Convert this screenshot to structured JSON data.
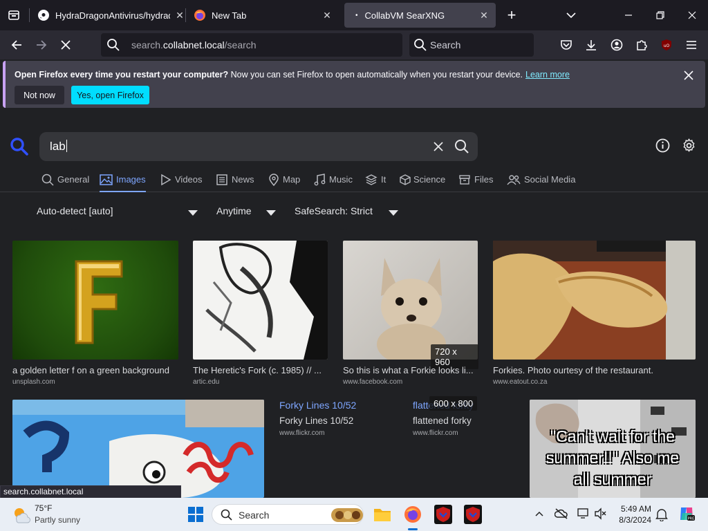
{
  "browser": {
    "tabs": [
      {
        "label": "HydraDragonAntivirus/hydrado"
      },
      {
        "label": "New Tab"
      },
      {
        "label": "CollabVM SearXNG"
      }
    ],
    "url_domain": "search.",
    "url_host": "collabnet.local",
    "url_path": "/search",
    "search_placeholder": "Search"
  },
  "notification": {
    "bold": "Open Firefox every time you restart your computer?",
    "text": " Now you can set Firefox to open automatically when you restart your device.",
    "learn_more": "Learn more",
    "not_now": "Not now",
    "yes": "Yes, open Firefox"
  },
  "searx": {
    "query": "lab",
    "categories": [
      {
        "label": "General"
      },
      {
        "label": "Images"
      },
      {
        "label": "Videos"
      },
      {
        "label": "News"
      },
      {
        "label": "Map"
      },
      {
        "label": "Music"
      },
      {
        "label": "It"
      },
      {
        "label": "Science"
      },
      {
        "label": "Files"
      },
      {
        "label": "Social Media"
      }
    ],
    "filters": {
      "language": "Auto-detect [auto]",
      "time": "Anytime",
      "safesearch": "SafeSearch: Strict"
    },
    "results": [
      {
        "title": "a golden letter f on a green background",
        "url": "unsplash.com"
      },
      {
        "title": "The Heretic's Fork (c. 1985) // ...",
        "url": "artic.edu"
      },
      {
        "title": "So this is what a Forkie looks li...",
        "url": "www.facebook.com",
        "dim": "720 x 960"
      },
      {
        "title": "Forkies. Photo ourtesy of the restaurant.",
        "url": "www.eatout.co.za"
      },
      {
        "link": "Forky Lines 10/52",
        "title": "Forky Lines 10/52",
        "url": "www.flickr.com"
      },
      {
        "link": "flattened forky",
        "title": "flattened forky",
        "url": "www.flickr.com",
        "dim": "600 x 800"
      }
    ],
    "meme_text": "\"Can't wait for the summer!!\" Also me all summer"
  },
  "status_url": "search.collabnet.local",
  "taskbar": {
    "temp": "75°F",
    "weather": "Partly sunny",
    "search": "Search",
    "time": "5:49 AM",
    "date": "8/3/2024"
  },
  "colors": {
    "accent": "#7ea6ff",
    "firefox_cyan": "#00ddff",
    "searx_blue": "#3050ff"
  }
}
